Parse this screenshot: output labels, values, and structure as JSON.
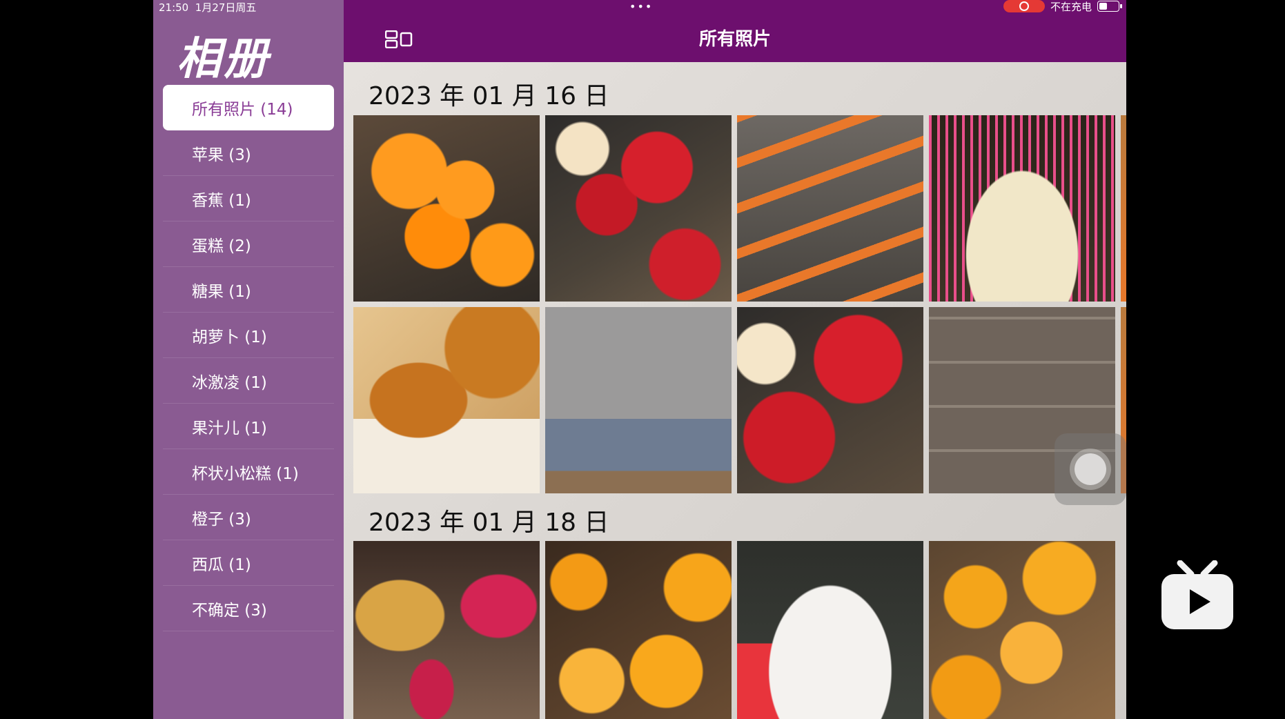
{
  "status_bar": {
    "time": "21:50",
    "date": "1月27日周五",
    "charging": "不在充电"
  },
  "sidebar": {
    "title": "相册",
    "items": [
      {
        "label": "所有照片 (14)",
        "active": true
      },
      {
        "label": "苹果 (3)"
      },
      {
        "label": "香蕉 (1)"
      },
      {
        "label": "蛋糕 (2)"
      },
      {
        "label": "糖果 (1)"
      },
      {
        "label": "胡萝卜 (1)"
      },
      {
        "label": "冰激凌 (1)"
      },
      {
        "label": "果汁儿 (1)"
      },
      {
        "label": "杯状小松糕 (1)"
      },
      {
        "label": "橙子 (3)"
      },
      {
        "label": "西瓜 (1)"
      },
      {
        "label": "不确定 (3)"
      }
    ]
  },
  "header": {
    "title": "所有照片"
  },
  "sections": [
    {
      "date": "2023 年 01 月 16 日"
    },
    {
      "date": "2023 年 01 月 18 日"
    }
  ],
  "icons": {
    "layout": "layout-toggle-icon",
    "assistive": "assistive-touch-icon",
    "overlay": "tv-play-icon"
  },
  "colors": {
    "header": "#6d0f6e",
    "sidebar": "#8a5b92",
    "active_text": "#8a3d96",
    "record": "#e53935"
  }
}
